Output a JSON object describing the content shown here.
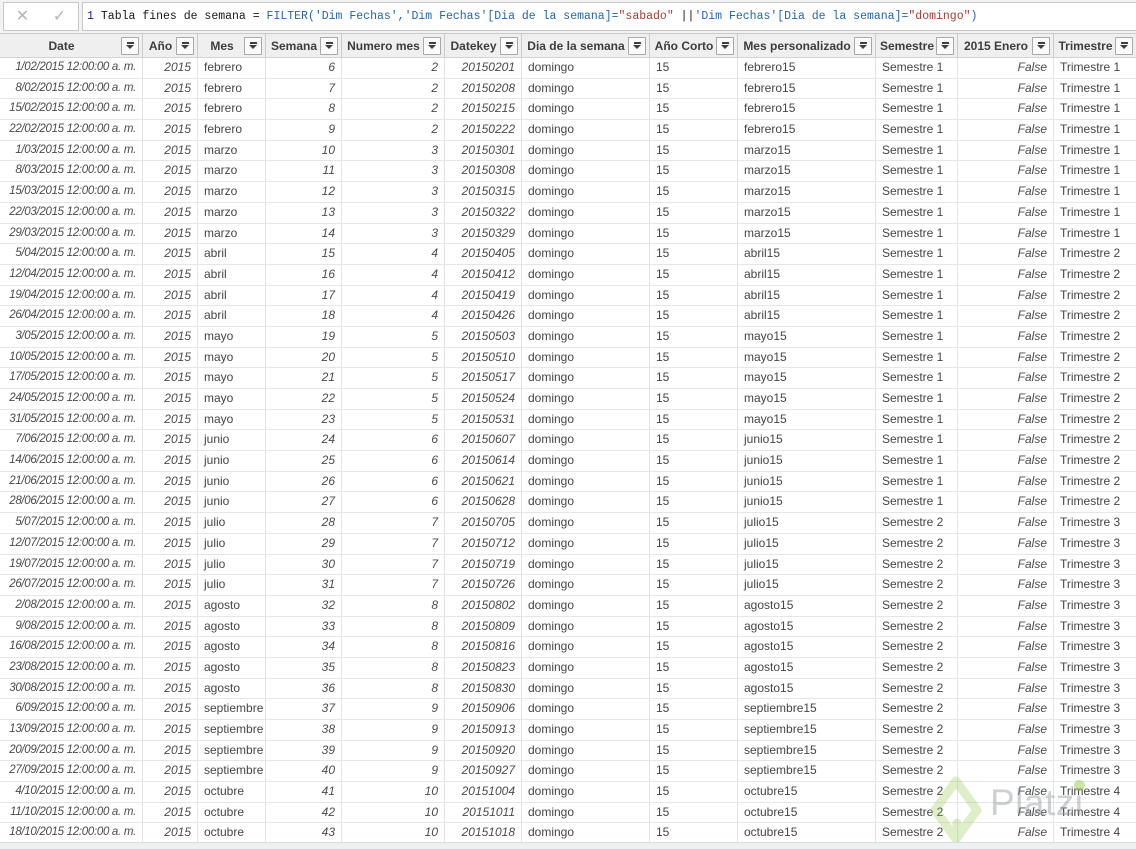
{
  "formula_bar": {
    "line_number": "1",
    "cancel_glyph": "✕",
    "commit_glyph": "✓",
    "segments": [
      {
        "text": "Tabla fines de semana = ",
        "type": "plain"
      },
      {
        "text": "FILTER('Dim Fechas','Dim Fechas'[Dia de la semana]=",
        "type": "blue"
      },
      {
        "text": "\"sabado\"",
        "type": "red"
      },
      {
        "text": " ||",
        "type": "plain"
      },
      {
        "text": "'Dim Fechas'[Dia de la semana]=",
        "type": "blue"
      },
      {
        "text": "\"domingo\"",
        "type": "red"
      },
      {
        "text": ")",
        "type": "blue"
      }
    ]
  },
  "table": {
    "columns": [
      {
        "label": "Date",
        "align": "right",
        "italic": true
      },
      {
        "label": "Año",
        "align": "right",
        "italic": true
      },
      {
        "label": "Mes",
        "align": "left",
        "italic": false
      },
      {
        "label": "Semana",
        "align": "right",
        "italic": true
      },
      {
        "label": "Numero mes",
        "align": "right",
        "italic": true
      },
      {
        "label": "Datekey",
        "align": "right",
        "italic": true
      },
      {
        "label": "Dia de la semana",
        "align": "left",
        "italic": false
      },
      {
        "label": "Año Corto",
        "align": "left",
        "italic": false
      },
      {
        "label": "Mes personalizado",
        "align": "left",
        "italic": false
      },
      {
        "label": "Semestre",
        "align": "left",
        "italic": false
      },
      {
        "label": "2015 Enero",
        "align": "right",
        "italic": true
      },
      {
        "label": "Trimestre",
        "align": "left",
        "italic": false
      }
    ],
    "rows": [
      [
        "1/02/2015 12:00:00 a. m.",
        "2015",
        "febrero",
        "6",
        "2",
        "20150201",
        "domingo",
        "15",
        "febrero15",
        "Semestre 1",
        "False",
        "Trimestre 1"
      ],
      [
        "8/02/2015 12:00:00 a. m.",
        "2015",
        "febrero",
        "7",
        "2",
        "20150208",
        "domingo",
        "15",
        "febrero15",
        "Semestre 1",
        "False",
        "Trimestre 1"
      ],
      [
        "15/02/2015 12:00:00 a. m.",
        "2015",
        "febrero",
        "8",
        "2",
        "20150215",
        "domingo",
        "15",
        "febrero15",
        "Semestre 1",
        "False",
        "Trimestre 1"
      ],
      [
        "22/02/2015 12:00:00 a. m.",
        "2015",
        "febrero",
        "9",
        "2",
        "20150222",
        "domingo",
        "15",
        "febrero15",
        "Semestre 1",
        "False",
        "Trimestre 1"
      ],
      [
        "1/03/2015 12:00:00 a. m.",
        "2015",
        "marzo",
        "10",
        "3",
        "20150301",
        "domingo",
        "15",
        "marzo15",
        "Semestre 1",
        "False",
        "Trimestre 1"
      ],
      [
        "8/03/2015 12:00:00 a. m.",
        "2015",
        "marzo",
        "11",
        "3",
        "20150308",
        "domingo",
        "15",
        "marzo15",
        "Semestre 1",
        "False",
        "Trimestre 1"
      ],
      [
        "15/03/2015 12:00:00 a. m.",
        "2015",
        "marzo",
        "12",
        "3",
        "20150315",
        "domingo",
        "15",
        "marzo15",
        "Semestre 1",
        "False",
        "Trimestre 1"
      ],
      [
        "22/03/2015 12:00:00 a. m.",
        "2015",
        "marzo",
        "13",
        "3",
        "20150322",
        "domingo",
        "15",
        "marzo15",
        "Semestre 1",
        "False",
        "Trimestre 1"
      ],
      [
        "29/03/2015 12:00:00 a. m.",
        "2015",
        "marzo",
        "14",
        "3",
        "20150329",
        "domingo",
        "15",
        "marzo15",
        "Semestre 1",
        "False",
        "Trimestre 1"
      ],
      [
        "5/04/2015 12:00:00 a. m.",
        "2015",
        "abril",
        "15",
        "4",
        "20150405",
        "domingo",
        "15",
        "abril15",
        "Semestre 1",
        "False",
        "Trimestre 2"
      ],
      [
        "12/04/2015 12:00:00 a. m.",
        "2015",
        "abril",
        "16",
        "4",
        "20150412",
        "domingo",
        "15",
        "abril15",
        "Semestre 1",
        "False",
        "Trimestre 2"
      ],
      [
        "19/04/2015 12:00:00 a. m.",
        "2015",
        "abril",
        "17",
        "4",
        "20150419",
        "domingo",
        "15",
        "abril15",
        "Semestre 1",
        "False",
        "Trimestre 2"
      ],
      [
        "26/04/2015 12:00:00 a. m.",
        "2015",
        "abril",
        "18",
        "4",
        "20150426",
        "domingo",
        "15",
        "abril15",
        "Semestre 1",
        "False",
        "Trimestre 2"
      ],
      [
        "3/05/2015 12:00:00 a. m.",
        "2015",
        "mayo",
        "19",
        "5",
        "20150503",
        "domingo",
        "15",
        "mayo15",
        "Semestre 1",
        "False",
        "Trimestre 2"
      ],
      [
        "10/05/2015 12:00:00 a. m.",
        "2015",
        "mayo",
        "20",
        "5",
        "20150510",
        "domingo",
        "15",
        "mayo15",
        "Semestre 1",
        "False",
        "Trimestre 2"
      ],
      [
        "17/05/2015 12:00:00 a. m.",
        "2015",
        "mayo",
        "21",
        "5",
        "20150517",
        "domingo",
        "15",
        "mayo15",
        "Semestre 1",
        "False",
        "Trimestre 2"
      ],
      [
        "24/05/2015 12:00:00 a. m.",
        "2015",
        "mayo",
        "22",
        "5",
        "20150524",
        "domingo",
        "15",
        "mayo15",
        "Semestre 1",
        "False",
        "Trimestre 2"
      ],
      [
        "31/05/2015 12:00:00 a. m.",
        "2015",
        "mayo",
        "23",
        "5",
        "20150531",
        "domingo",
        "15",
        "mayo15",
        "Semestre 1",
        "False",
        "Trimestre 2"
      ],
      [
        "7/06/2015 12:00:00 a. m.",
        "2015",
        "junio",
        "24",
        "6",
        "20150607",
        "domingo",
        "15",
        "junio15",
        "Semestre 1",
        "False",
        "Trimestre 2"
      ],
      [
        "14/06/2015 12:00:00 a. m.",
        "2015",
        "junio",
        "25",
        "6",
        "20150614",
        "domingo",
        "15",
        "junio15",
        "Semestre 1",
        "False",
        "Trimestre 2"
      ],
      [
        "21/06/2015 12:00:00 a. m.",
        "2015",
        "junio",
        "26",
        "6",
        "20150621",
        "domingo",
        "15",
        "junio15",
        "Semestre 1",
        "False",
        "Trimestre 2"
      ],
      [
        "28/06/2015 12:00:00 a. m.",
        "2015",
        "junio",
        "27",
        "6",
        "20150628",
        "domingo",
        "15",
        "junio15",
        "Semestre 1",
        "False",
        "Trimestre 2"
      ],
      [
        "5/07/2015 12:00:00 a. m.",
        "2015",
        "julio",
        "28",
        "7",
        "20150705",
        "domingo",
        "15",
        "julio15",
        "Semestre 2",
        "False",
        "Trimestre 3"
      ],
      [
        "12/07/2015 12:00:00 a. m.",
        "2015",
        "julio",
        "29",
        "7",
        "20150712",
        "domingo",
        "15",
        "julio15",
        "Semestre 2",
        "False",
        "Trimestre 3"
      ],
      [
        "19/07/2015 12:00:00 a. m.",
        "2015",
        "julio",
        "30",
        "7",
        "20150719",
        "domingo",
        "15",
        "julio15",
        "Semestre 2",
        "False",
        "Trimestre 3"
      ],
      [
        "26/07/2015 12:00:00 a. m.",
        "2015",
        "julio",
        "31",
        "7",
        "20150726",
        "domingo",
        "15",
        "julio15",
        "Semestre 2",
        "False",
        "Trimestre 3"
      ],
      [
        "2/08/2015 12:00:00 a. m.",
        "2015",
        "agosto",
        "32",
        "8",
        "20150802",
        "domingo",
        "15",
        "agosto15",
        "Semestre 2",
        "False",
        "Trimestre 3"
      ],
      [
        "9/08/2015 12:00:00 a. m.",
        "2015",
        "agosto",
        "33",
        "8",
        "20150809",
        "domingo",
        "15",
        "agosto15",
        "Semestre 2",
        "False",
        "Trimestre 3"
      ],
      [
        "16/08/2015 12:00:00 a. m.",
        "2015",
        "agosto",
        "34",
        "8",
        "20150816",
        "domingo",
        "15",
        "agosto15",
        "Semestre 2",
        "False",
        "Trimestre 3"
      ],
      [
        "23/08/2015 12:00:00 a. m.",
        "2015",
        "agosto",
        "35",
        "8",
        "20150823",
        "domingo",
        "15",
        "agosto15",
        "Semestre 2",
        "False",
        "Trimestre 3"
      ],
      [
        "30/08/2015 12:00:00 a. m.",
        "2015",
        "agosto",
        "36",
        "8",
        "20150830",
        "domingo",
        "15",
        "agosto15",
        "Semestre 2",
        "False",
        "Trimestre 3"
      ],
      [
        "6/09/2015 12:00:00 a. m.",
        "2015",
        "septiembre",
        "37",
        "9",
        "20150906",
        "domingo",
        "15",
        "septiembre15",
        "Semestre 2",
        "False",
        "Trimestre 3"
      ],
      [
        "13/09/2015 12:00:00 a. m.",
        "2015",
        "septiembre",
        "38",
        "9",
        "20150913",
        "domingo",
        "15",
        "septiembre15",
        "Semestre 2",
        "False",
        "Trimestre 3"
      ],
      [
        "20/09/2015 12:00:00 a. m.",
        "2015",
        "septiembre",
        "39",
        "9",
        "20150920",
        "domingo",
        "15",
        "septiembre15",
        "Semestre 2",
        "False",
        "Trimestre 3"
      ],
      [
        "27/09/2015 12:00:00 a. m.",
        "2015",
        "septiembre",
        "40",
        "9",
        "20150927",
        "domingo",
        "15",
        "septiembre15",
        "Semestre 2",
        "False",
        "Trimestre 3"
      ],
      [
        "4/10/2015 12:00:00 a. m.",
        "2015",
        "octubre",
        "41",
        "10",
        "20151004",
        "domingo",
        "15",
        "octubre15",
        "Semestre 2",
        "False",
        "Trimestre 4"
      ],
      [
        "11/10/2015 12:00:00 a. m.",
        "2015",
        "octubre",
        "42",
        "10",
        "20151011",
        "domingo",
        "15",
        "octubre15",
        "Semestre 2",
        "False",
        "Trimestre 4"
      ],
      [
        "18/10/2015 12:00:00 a. m.",
        "2015",
        "octubre",
        "43",
        "10",
        "20151018",
        "domingo",
        "15",
        "octubre15",
        "Semestre 2",
        "False",
        "Trimestre 4"
      ]
    ]
  },
  "watermark": {
    "text": "Platzi"
  },
  "colors": {
    "dax_blue": "#2565ae",
    "dax_string_red": "#a83c32",
    "line_number_navy": "#1d1d94",
    "header_bg": "#efefef",
    "watermark_green": "#8cc63f"
  }
}
